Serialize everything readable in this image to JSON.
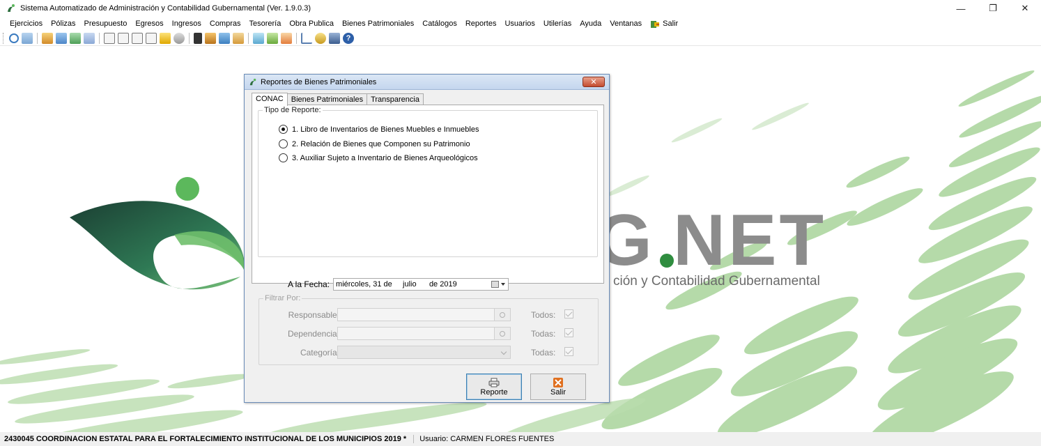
{
  "window": {
    "title": "Sistema Automatizado de Administración y Contabilidad Gubernamental  (Ver. 1.9.0.3)",
    "minimize": "—",
    "maximize": "❐",
    "close": "✕"
  },
  "menu": {
    "items": [
      "Ejercicios",
      "Pólizas",
      "Presupuesto",
      "Egresos",
      "Ingresos",
      "Compras",
      "Tesorería",
      "Obra Publica",
      "Bienes Patrimoniales",
      "Catálogos",
      "Reportes",
      "Usuarios",
      "Utilerías",
      "Ayuda",
      "Ventanas"
    ],
    "salir": "Salir"
  },
  "background": {
    "logo_text": ".NET",
    "logo_partial": "G",
    "tagline": "ción y Contabilidad Gubernamental"
  },
  "dialog": {
    "title": "Reportes de Bienes Patrimoniales",
    "close": "✕",
    "tabs": [
      "CONAC",
      "Bienes Patrimoniales",
      "Transparencia"
    ],
    "tipo_reporte_label": "Tipo de Reporte:",
    "options": [
      "1.  Libro de Inventarios de Bienes Muebles e Inmuebles",
      "2.  Relación de Bienes que Componen su Patrimonio",
      "3.  Auxiliar Sujeto a Inventario de Bienes Arqueológicos"
    ],
    "selected_option": 0,
    "fecha_label": "A la Fecha:",
    "fecha_value": "miércoles, 31 de     julio      de 2019",
    "filtrar_label": "Filtrar Por:",
    "filters": {
      "responsable": {
        "label": "Responsable:",
        "todos": "Todos:"
      },
      "dependencia": {
        "label": "Dependencia:",
        "todos": "Todas:"
      },
      "categoria": {
        "label": "Categoría:",
        "todos": "Todas:"
      }
    },
    "buttons": {
      "reporte": "Reporte",
      "salir": "Salir"
    }
  },
  "status": {
    "entity": "2430045 COORDINACION ESTATAL PARA EL FORTALECIMIENTO INSTITUCIONAL DE LOS MUNICIPIOS  2019   *",
    "user": "Usuario: CARMEN FLORES FUENTES"
  },
  "colors": {
    "brand_green": "#5cb85c",
    "dark_green": "#1f4d3a",
    "logo_gray": "#8c8c8c",
    "stripe_green": "#9ccf8a"
  }
}
